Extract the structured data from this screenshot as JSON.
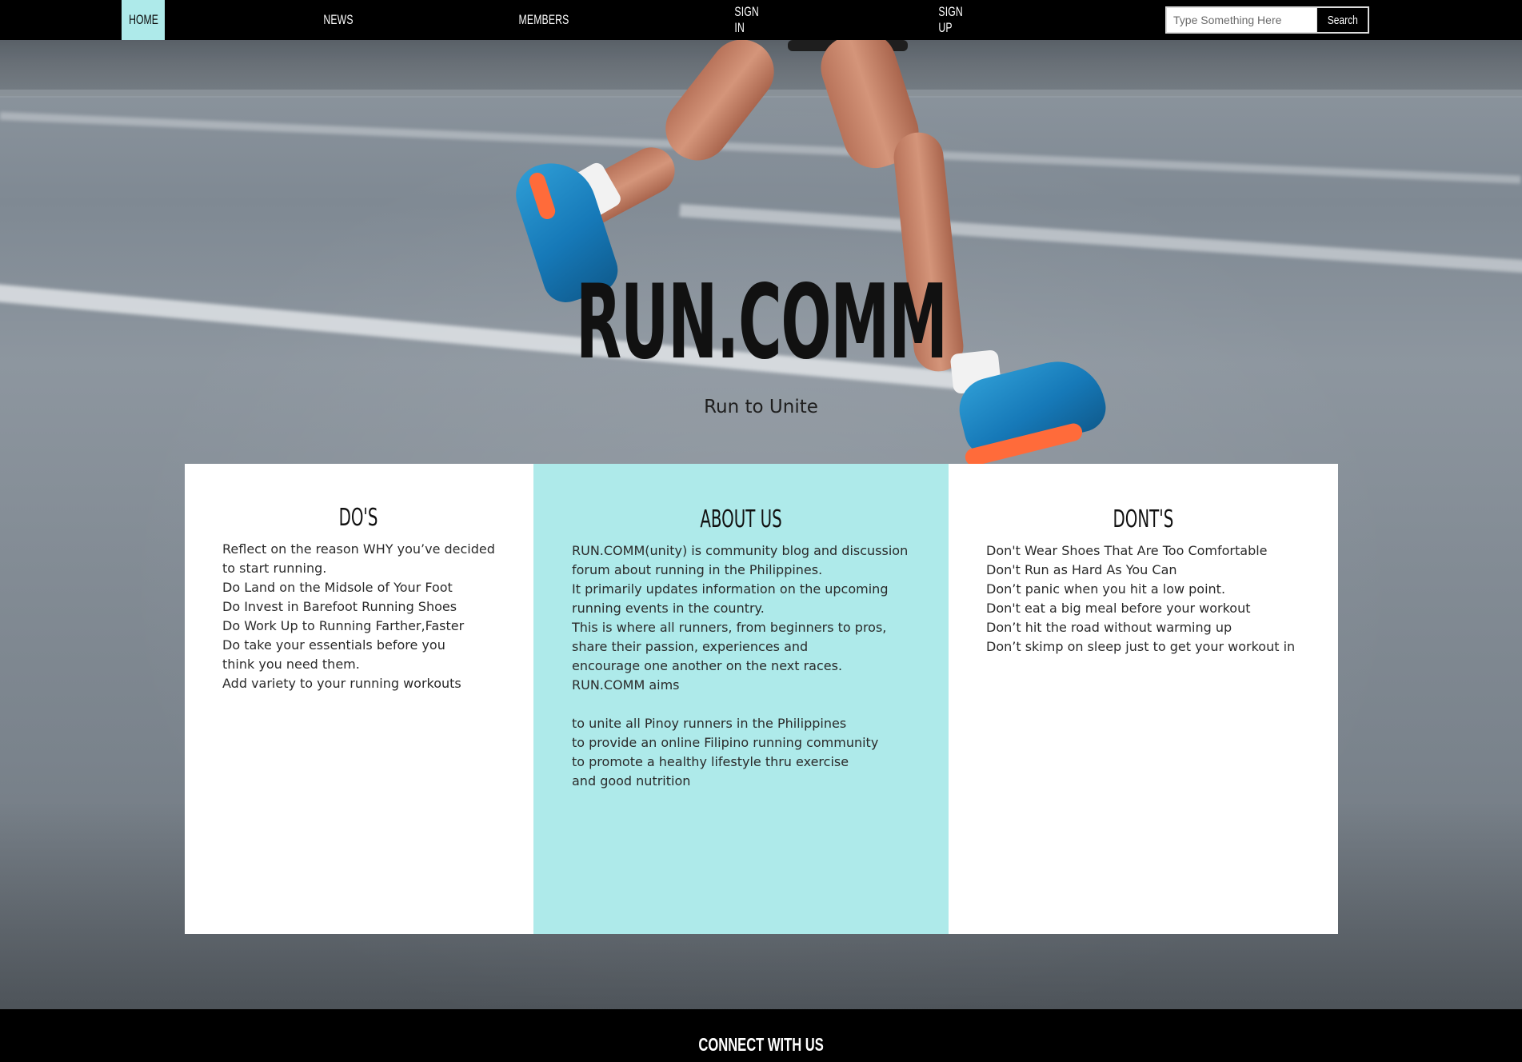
{
  "nav": {
    "items": [
      {
        "label": "HOME",
        "active": true
      },
      {
        "label": "NEWS"
      },
      {
        "label": "MEMBERS"
      },
      {
        "label": "SIGN IN"
      },
      {
        "label": "SIGN UP"
      }
    ],
    "search": {
      "placeholder": "Type Something Here",
      "button_label": "Search"
    },
    "active_color": "#aeeaea"
  },
  "hero": {
    "title": "RUN.COMM",
    "tagline": "Run to Unite"
  },
  "panels": {
    "dos": {
      "heading": "DO'S",
      "lines": [
        "Reflect on the reason WHY you’ve decided",
        "to start running.",
        "Do Land on the Midsole of Your Foot",
        "Do Invest in Barefoot Running Shoes",
        "Do Work Up to Running Farther,Faster",
        "Do take your essentials before you",
        "think you need them.",
        "Add variety to your running workouts"
      ]
    },
    "about": {
      "heading": "ABOUT US",
      "lines": [
        "RUN.COMM(unity) is community blog and discussion",
        "forum about running in the Philippines.",
        "It primarily updates information on the upcoming",
        "running events in the country.",
        "This is where all runners, from beginners to pros,",
        "share their passion, experiences and",
        "encourage one another on the next races.",
        "RUN.COMM aims"
      ],
      "aims": [
        "to unite all Pinoy runners in the Philippines",
        "to provide an online Filipino running community",
        "to promote a healthy lifestyle thru exercise",
        "and good nutrition"
      ],
      "background": "#aeeaea"
    },
    "donts": {
      "heading": "DONT'S",
      "lines": [
        "Don't Wear Shoes That Are Too Comfortable",
        "Don't Run as Hard As You Can",
        "Don’t panic when you hit a low point.",
        "Don't eat a big meal before your workout",
        "Don’t hit the road without warming up",
        "Don’t skimp on sleep just to get your workout in"
      ]
    }
  },
  "footer": {
    "title": "CONNECT WITH US"
  }
}
